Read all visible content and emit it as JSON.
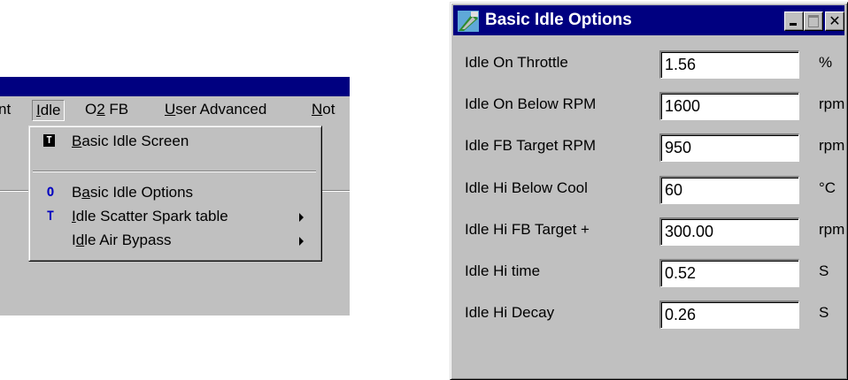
{
  "menubar": {
    "items": [
      {
        "label": "nt"
      },
      {
        "label": "Idle",
        "mnemonic": "I",
        "rest": "dle"
      },
      {
        "label": "O2 FB",
        "before": "O",
        "mnemonic": "2",
        "rest": " FB"
      },
      {
        "label": "User Advanced",
        "mnemonic": "U",
        "rest": "ser Advanced"
      },
      {
        "label": "Not",
        "mnemonic": "N",
        "rest": "ot"
      }
    ]
  },
  "idle_menu": {
    "items": [
      {
        "icon": "T",
        "icon_name": "table-box-icon",
        "mnemonic": "B",
        "rest": "asic Idle Screen"
      },
      {
        "icon": "O",
        "icon_name": "options-o-icon",
        "icon_color": "#0000c0",
        "before": "B",
        "mnemonic": "a",
        "rest": "sic Idle Options"
      },
      {
        "icon": "T",
        "icon_name": "table-t-icon",
        "icon_color": "#0000c0",
        "mnemonic": "I",
        "rest": "dle Scatter Spark table"
      },
      {
        "before": "I",
        "mnemonic": "d",
        "rest": "le Air Bypass"
      }
    ]
  },
  "dialog": {
    "title": "Basic Idle Options",
    "fields": [
      {
        "label": "Idle On Throttle",
        "value": "1.56",
        "unit": "%"
      },
      {
        "label": "Idle On Below RPM",
        "value": "1600",
        "unit": "rpm"
      },
      {
        "label": "Idle FB Target RPM",
        "value": "950",
        "unit": "rpm"
      },
      {
        "label": "Idle Hi Below Cool",
        "value": "60",
        "unit": "°C"
      },
      {
        "label": "Idle Hi FB Target +",
        "value": "300.00",
        "unit": "rpm"
      },
      {
        "label": "Idle Hi time",
        "value": "0.52",
        "unit": "S"
      },
      {
        "label": "Idle Hi Decay",
        "value": "0.26",
        "unit": "S"
      }
    ]
  },
  "colors": {
    "face": "#c0c0c0",
    "titlebar": "#000080",
    "menu_icon_blue": "#0000c0"
  }
}
